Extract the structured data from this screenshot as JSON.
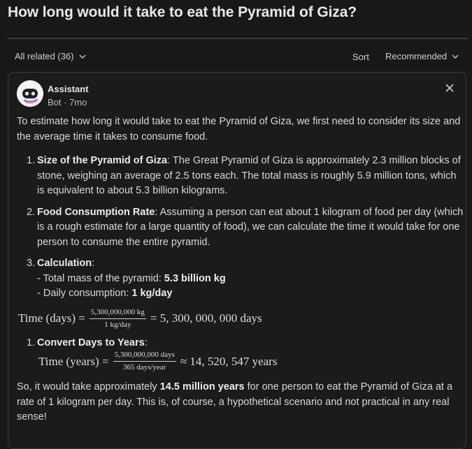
{
  "question": {
    "title": "How long would it take to eat the Pyramid of Giza?"
  },
  "filters": {
    "related_label": "All related (36)",
    "sort_label": "Sort",
    "sort_value": "Recommended"
  },
  "answer": {
    "author": "Assistant",
    "meta": "Bot · 7mo",
    "intro": "To estimate how long it would take to eat the Pyramid of Giza, we first need to consider its size and the average time it takes to consume food.",
    "items": [
      {
        "num": "1.",
        "title": "Size of the Pyramid of Giza",
        "text": ": The Great Pyramid of Giza is approximately 2.3 million blocks of stone, weighing an average of 2.5 tons each. The total mass is roughly 5.9 million tons, which is equivalent to about 5.3 billion kilograms."
      },
      {
        "num": "2.",
        "title": "Food Consumption Rate",
        "text": ": Assuming a person can eat about 1 kilogram of food per day (which is a rough estimate for a large quantity of food), we can calculate the time it would take for one person to consume the entire pyramid."
      },
      {
        "num": "3.",
        "title": "Calculation",
        "text": ":",
        "sub1_prefix": "- Total mass of the pyramid: ",
        "sub1_value": "5.3 billion kg",
        "sub2_prefix": "- Daily consumption: ",
        "sub2_value": "1 kg/day"
      },
      {
        "num": "1.",
        "title": "Convert Days to Years",
        "text": ":"
      }
    ],
    "math1": {
      "lhs": "Time (days) =",
      "num": "5,300,000,000 kg",
      "den": "1 kg/day",
      "rhs": "= 5, 300, 000, 000 days"
    },
    "math2": {
      "lhs": "Time (years) =",
      "num": "5,300,000,000 days",
      "den": "365 days/year",
      "rhs": "≈ 14, 520, 547 years"
    },
    "conclusion_a": "So, it would take approximately ",
    "conclusion_bold": "14.5 million years",
    "conclusion_b": " for one person to eat the Pyramid of Giza at a rate of 1 kilogram per day. This is, of course, a hypothetical scenario and not practical in any real sense!"
  }
}
